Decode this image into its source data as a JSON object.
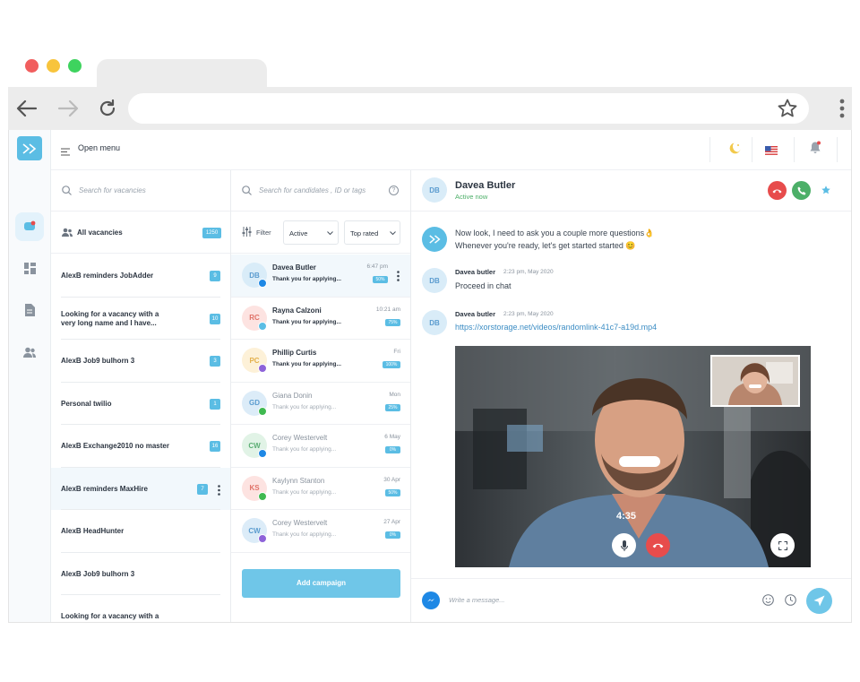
{
  "browser": {
    "dots": [
      "#f15e5e",
      "#f8c43c",
      "#3ed35e"
    ],
    "icons": [
      "back-arrow-icon",
      "forward-arrow-icon",
      "reload-icon",
      "star-icon",
      "kebab-menu-icon"
    ]
  },
  "topbar": {
    "menu_label": "Open menu"
  },
  "vacancies": {
    "search_placeholder": "Search for vacancies",
    "header_label": "All vacancies",
    "header_count": "1250",
    "items": [
      {
        "title": "AlexB reminders JobAdder",
        "count": "9"
      },
      {
        "title": "Looking for a vacancy with a very long name and I have...",
        "count": "10"
      },
      {
        "title": "AlexB Job9 bulhorn 3",
        "count": "3"
      },
      {
        "title": "Personal twilio",
        "count": "1"
      },
      {
        "title": "AlexB Exchange2010 no master",
        "count": "16"
      },
      {
        "title": "AlexB reminders MaxHire",
        "count": "7"
      },
      {
        "title": "AlexB HeadHunter",
        "count": ""
      },
      {
        "title": "AlexB Job9 bulhorn 3",
        "count": ""
      },
      {
        "title": "Looking for a vacancy with a",
        "count": ""
      }
    ]
  },
  "candidates": {
    "search_placeholder": "Search for candidates , ID or tags",
    "filter_label": "Filter",
    "status_select": "Active",
    "sort_select": "Top rated",
    "items": [
      {
        "initials": "DB",
        "name": "Davea Butler",
        "message": "Thank you for applying...",
        "time": "6:47 pm",
        "percent": "50%",
        "avatar_bg": "#d9ecf8",
        "avatar_fg": "#5b9ccf",
        "channel_color": "#1e88e5"
      },
      {
        "initials": "RC",
        "name": "Rayna Calzoni",
        "message": "Thank you for applying...",
        "time": "10:21 am",
        "percent": "75%",
        "avatar_bg": "#fde3e1",
        "avatar_fg": "#e07268",
        "channel_color": "#5bbde4"
      },
      {
        "initials": "PC",
        "name": "Phillip Curtis",
        "message": "Thank you for applying...",
        "time": "Fri",
        "percent": "100%",
        "avatar_bg": "#fdf1d8",
        "avatar_fg": "#e3b04b",
        "channel_color": "#8e63d9"
      },
      {
        "initials": "GD",
        "name": "Giana Donin",
        "message": "Thank you for applying...",
        "time": "Mon",
        "percent": "25%",
        "avatar_bg": "#dcecf8",
        "avatar_fg": "#5b9ccf",
        "channel_color": "#3fb950"
      },
      {
        "initials": "CW",
        "name": "Corey Westervelt",
        "message": "Thank you for applying...",
        "time": "6 May",
        "percent": "0%",
        "avatar_bg": "#e1f3e6",
        "avatar_fg": "#5cae74",
        "channel_color": "#1e88e5"
      },
      {
        "initials": "KS",
        "name": "Kaylynn Stanton",
        "message": "Thank you for applying...",
        "time": "30 Apr",
        "percent": "50%",
        "avatar_bg": "#fde3e1",
        "avatar_fg": "#e07268",
        "channel_color": "#3fb950"
      },
      {
        "initials": "CW",
        "name": "Corey Westervelt",
        "message": "Thank you for applying...",
        "time": "27 Apr",
        "percent": "0%",
        "avatar_bg": "#dcecf8",
        "avatar_fg": "#5b9ccf",
        "channel_color": "#8e63d9"
      }
    ],
    "add_campaign_label": "Add campaign"
  },
  "chat": {
    "contact_initials": "DB",
    "contact_name": "Davea Butler",
    "contact_status": "Active now",
    "messages": [
      {
        "line1": "Now look, I need to ask you a couple more questions👌",
        "line2": "Whenever you're ready, let's get started started 😊"
      },
      {
        "initials": "DB",
        "author": "Davea butler",
        "meta": "2:23 pm, May 2020",
        "text": "Proceed in chat"
      },
      {
        "initials": "DB",
        "author": "Davea butler",
        "meta": "2:23 pm, May 2020",
        "link": "https://xorstorage.net/videos/randomlink-41c7-a19d.mp4"
      }
    ],
    "video": {
      "timer": "4:35"
    },
    "input_placeholder": "Write a message..."
  },
  "colors": {
    "accent": "#5bbde4",
    "decline": "#e74c4c",
    "accept": "#4caf68",
    "active_green": "#4caf68",
    "link": "#3c8dc4"
  }
}
